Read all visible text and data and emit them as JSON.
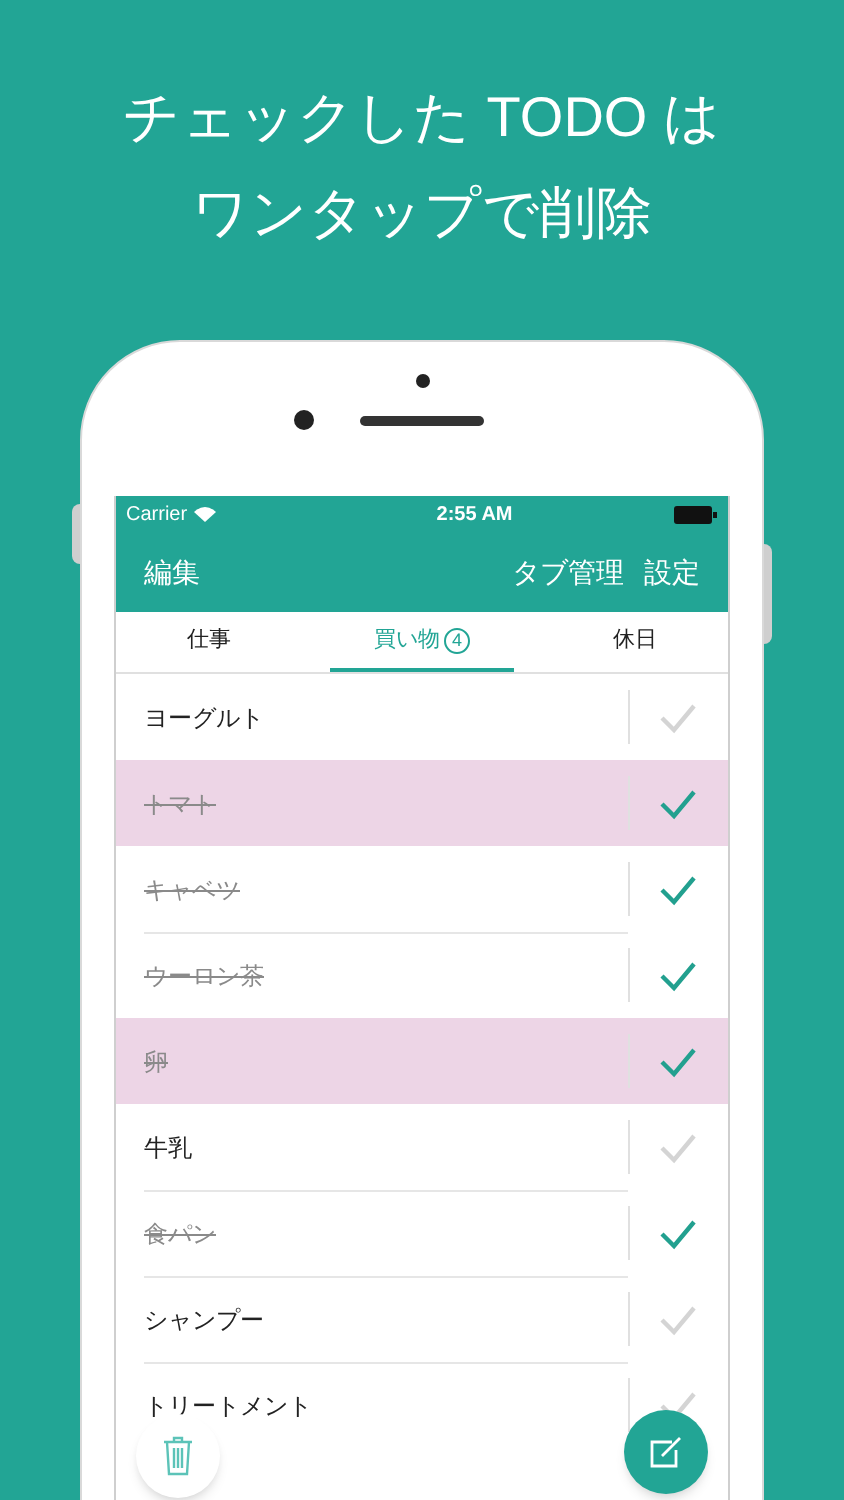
{
  "headline": [
    "チェックした TODO は",
    "ワンタップで削除"
  ],
  "status_bar": {
    "carrier": "Carrier",
    "time": "2:55 AM"
  },
  "nav_bar": {
    "left": "編集",
    "right": [
      "タブ管理",
      "設定"
    ]
  },
  "tabs": [
    {
      "label": "仕事",
      "selected": false
    },
    {
      "label": "買い物",
      "badge": "4",
      "selected": true
    },
    {
      "label": "休日",
      "selected": false
    }
  ],
  "items": [
    {
      "text": "ヨーグルト",
      "checked": false,
      "highlighted": false
    },
    {
      "text": "トマト",
      "checked": true,
      "highlighted": true
    },
    {
      "text": "キャベツ",
      "checked": true,
      "highlighted": false
    },
    {
      "text": "ウーロン茶",
      "checked": true,
      "highlighted": false
    },
    {
      "text": "卵",
      "checked": true,
      "highlighted": true
    },
    {
      "text": "牛乳",
      "checked": false,
      "highlighted": false
    },
    {
      "text": "食パン",
      "checked": true,
      "highlighted": false
    },
    {
      "text": "シャンプー",
      "checked": false,
      "highlighted": false
    },
    {
      "text": "トリートメント",
      "checked": false,
      "highlighted": false
    }
  ]
}
